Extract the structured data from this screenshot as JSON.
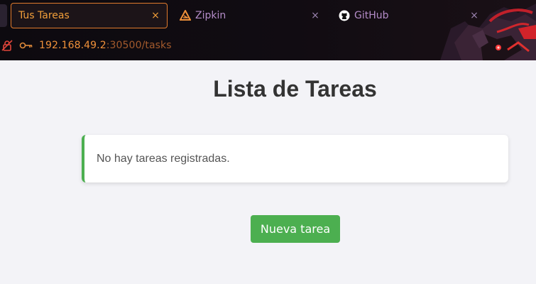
{
  "browser": {
    "tabs": [
      {
        "label": "Tus Tareas",
        "active": true,
        "icon": "none"
      },
      {
        "label": "Zipkin",
        "active": false,
        "icon": "zipkin-logo"
      },
      {
        "label": "GitHub",
        "active": false,
        "icon": "github-logo"
      }
    ],
    "close_glyph": "×",
    "new_tab_glyph": "+",
    "address": {
      "host": "192.168.49.2",
      "path": ":30500/tasks"
    },
    "colors": {
      "accent": "#f29f3a",
      "inactive_tab_text": "#b48cc8",
      "url_host": "#f0913a",
      "url_path": "#a35a2c"
    }
  },
  "page": {
    "title": "Lista de Tareas",
    "empty_message": "No hay tareas registradas.",
    "new_task_label": "Nueva tarea",
    "colors": {
      "button": "#4caf50",
      "alert_border": "#4caf50",
      "background": "#f3f3f7"
    }
  }
}
